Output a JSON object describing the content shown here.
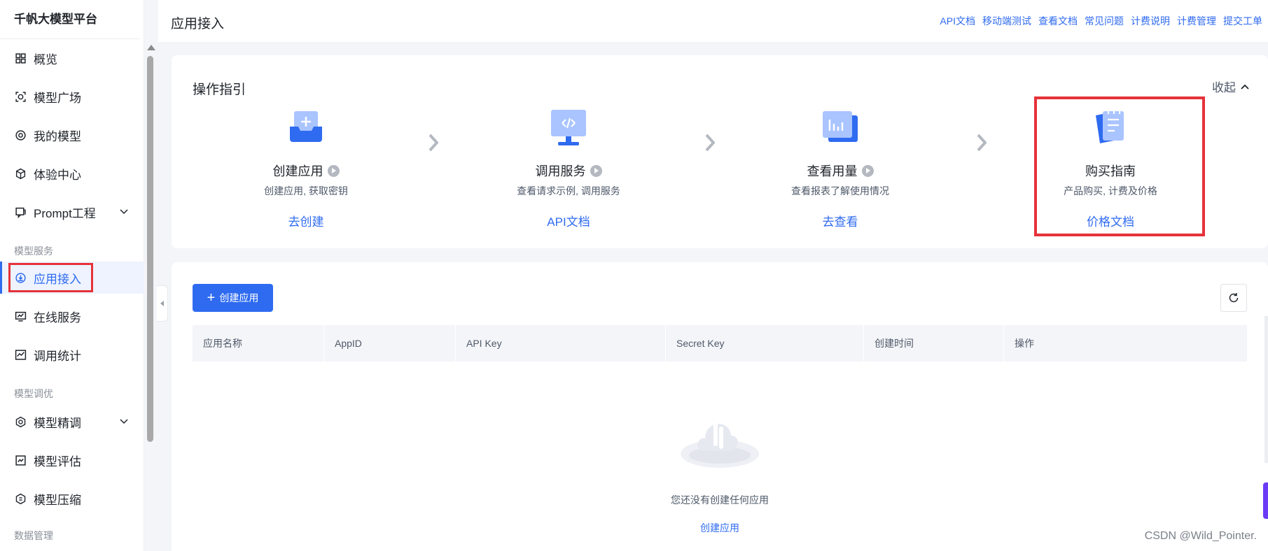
{
  "sidebar": {
    "brand": "千帆大模型平台",
    "items": [
      {
        "label": "概览",
        "icon": "grid-icon"
      },
      {
        "label": "模型广场",
        "icon": "model-square-icon"
      },
      {
        "label": "我的模型",
        "icon": "my-model-icon"
      },
      {
        "label": "体验中心",
        "icon": "cube-icon"
      },
      {
        "label": "Prompt工程",
        "icon": "prompt-icon"
      },
      {
        "label": "应用接入",
        "icon": "app-access-icon"
      },
      {
        "label": "在线服务",
        "icon": "monitor-icon"
      },
      {
        "label": "调用统计",
        "icon": "chart-icon"
      },
      {
        "label": "模型精调",
        "icon": "tune-icon"
      },
      {
        "label": "模型评估",
        "icon": "evaluate-icon"
      },
      {
        "label": "模型压缩",
        "icon": "compress-icon"
      }
    ],
    "sections": [
      "模型服务",
      "模型调优",
      "数据管理"
    ]
  },
  "header": {
    "title": "应用接入",
    "links": [
      "API文档",
      "移动端测试",
      "查看文档",
      "常见问题",
      "计费说明",
      "计费管理",
      "提交工单"
    ]
  },
  "guide": {
    "title": "操作指引",
    "collapse_label": "收起",
    "steps": [
      {
        "name": "创建应用",
        "desc": "创建应用, 获取密钥",
        "link": "去创建"
      },
      {
        "name": "调用服务",
        "desc": "查看请求示例, 调用服务",
        "link": "API文档"
      },
      {
        "name": "查看用量",
        "desc": "查看报表了解使用情况",
        "link": "去查看"
      },
      {
        "name": "购买指南",
        "desc": "产品购买, 计费及价格",
        "link": "价格文档"
      }
    ]
  },
  "apps": {
    "create_button": "创建应用",
    "columns": [
      "应用名称",
      "AppID",
      "API Key",
      "Secret Key",
      "创建时间",
      "操作"
    ],
    "empty_text": "您还没有创建任何应用",
    "empty_link": "创建应用"
  },
  "watermark": "CSDN @Wild_Pointer.",
  "colors": {
    "accent": "#2f6bf0",
    "highlight_border": "#e6323a",
    "active_bg": "#eef3ff"
  }
}
